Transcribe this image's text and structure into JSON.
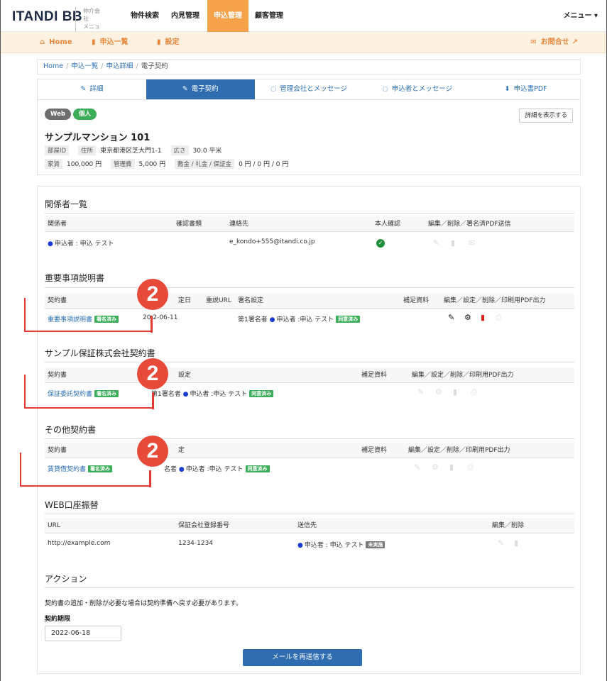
{
  "topnav": {
    "logo": "ITANDI BB",
    "logo_sub": "仲介会社\nメニュー",
    "items": [
      "物件検索",
      "内見管理",
      "申込管理",
      "顧客管理"
    ],
    "menu": "メニュー ▾"
  },
  "subnav": {
    "home": "Home",
    "list": "申込一覧",
    "settings": "設定",
    "contact": "お問合せ"
  },
  "breadcrumb": [
    "Home",
    "申込一覧",
    "申込詳細",
    "電子契約"
  ],
  "tabs": [
    "詳細",
    "電子契約",
    "管理会社とメッセージ",
    "申込者とメッセージ",
    "申込書PDF"
  ],
  "property": {
    "tag_web": "Web",
    "tag_kojin": "個人",
    "detail_button": "詳細を表示する",
    "name": "サンプルマンション 101",
    "room_id_label": "部屋ID",
    "address_label": "住所",
    "address": "東京都港区芝大門1-1",
    "area_label": "広さ",
    "area": "30.0 平米",
    "rent_label": "家賃",
    "rent": "100,000 円",
    "fee_label": "管理費",
    "fee": "5,000 円",
    "deposit_label": "敷金 / 礼金 / 保証金",
    "deposit": "0 円 / 0 円 / 0 円"
  },
  "parties": {
    "title": "関係者一覧",
    "headers": [
      "関係者",
      "確認書類",
      "連絡先",
      "本人確認",
      "編集／削除／署名済PDF送信"
    ],
    "row": {
      "party": "申込者 : 申込 テスト",
      "contact": "e_kondo+555@itandi.co.jp"
    }
  },
  "important": {
    "title": "重要事項説明書",
    "headers": [
      "契約書",
      "定日",
      "重説URL",
      "署名設定",
      "補足資料",
      "編集／設定／削除／印刷用PDF出力"
    ],
    "row": {
      "doc": "重要事項説明書",
      "signed": "署名済み",
      "date": "20 2-06-11",
      "signer": "第1署名者",
      "party": "申込者 :申込 テスト",
      "agreed": "同意済み"
    }
  },
  "guarantee": {
    "title": "サンプル保証株式会社契約書",
    "headers": [
      "契約書",
      "設定",
      "補足資料",
      "編集／設定／削除／印刷用PDF出力"
    ],
    "row": {
      "doc": "保証委託契約書",
      "signed": "署名済み",
      "signer": "第1署名者",
      "party": "申込者 :申込 テスト",
      "agreed": "同意済み"
    }
  },
  "other": {
    "title": "その他契約書",
    "headers": [
      "契約書",
      "定",
      "補足資料",
      "編集／設定／削除／印刷用PDF出力"
    ],
    "row": {
      "doc": "賃貸借契約書",
      "signed": "署名済み",
      "signer": "名者",
      "party": "申込者 :申込 テスト",
      "agreed": "同意済み"
    }
  },
  "web_transfer": {
    "title": "WEB口座振替",
    "headers": [
      "URL",
      "保証会社登録番号",
      "送信先",
      "編集／削除"
    ],
    "row": {
      "url": "http://example.com",
      "number": "1234-1234",
      "party": "申込者 : 申込 テスト",
      "status": "未実施"
    }
  },
  "action": {
    "title": "アクション",
    "note": "契約書の追加・削除が必要な場合は契約準備へ戻す必要があります。",
    "deadline_label": "契約期限",
    "deadline": "2022-06-18",
    "resend_button": "メールを再送信する"
  },
  "annotations": [
    "2",
    "2",
    "2"
  ],
  "colors": {
    "accent": "#f5a24a",
    "primary": "#2f6db0",
    "annotation": "#e53935",
    "green": "#3cae5a"
  }
}
